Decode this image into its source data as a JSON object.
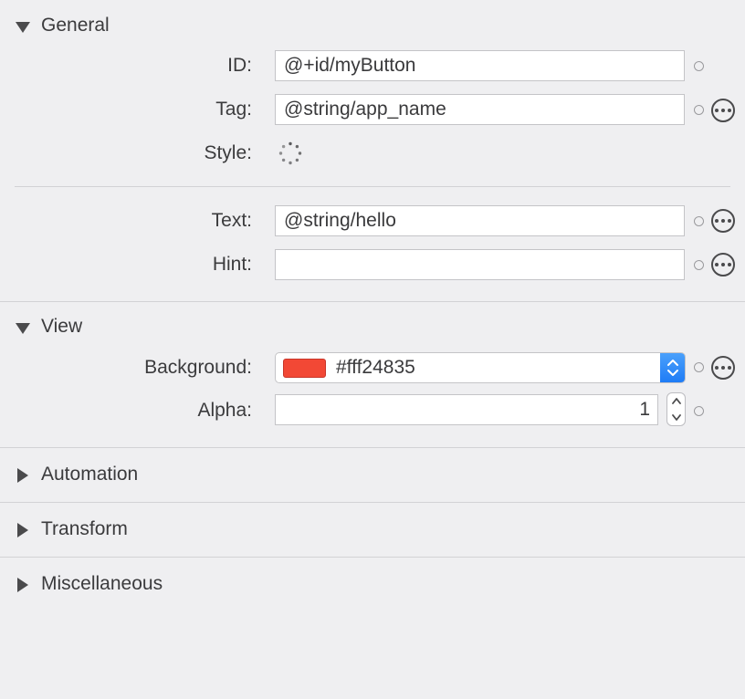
{
  "sections": {
    "general": {
      "title": "General",
      "expanded": true
    },
    "view": {
      "title": "View",
      "expanded": true
    },
    "automation": {
      "title": "Automation",
      "expanded": false
    },
    "transform": {
      "title": "Transform",
      "expanded": false
    },
    "miscellaneous": {
      "title": "Miscellaneous",
      "expanded": false
    }
  },
  "general": {
    "id": {
      "label": "ID:",
      "value": "@+id/myButton"
    },
    "tag": {
      "label": "Tag:",
      "value": "@string/app_name"
    },
    "style": {
      "label": "Style:",
      "loading_icon": "spinner-icon"
    },
    "text": {
      "label": "Text:",
      "value": "@string/hello"
    },
    "hint": {
      "label": "Hint:",
      "value": ""
    }
  },
  "view": {
    "background": {
      "label": "Background:",
      "value": "#fff24835",
      "swatch_color": "#f24835"
    },
    "alpha": {
      "label": "Alpha:",
      "value": "1"
    }
  },
  "colors": {
    "panel_background": "#efeff1",
    "accent": "#1f7cf6",
    "label_text": "#3b3b3d"
  },
  "icons": {
    "more": "ellipsis-circle-icon",
    "binding_indicator": "small-circle-icon",
    "disclosure_open": "triangle-down-icon",
    "disclosure_closed": "triangle-right-icon",
    "popup_arrows": "up-down-chevron-icon"
  }
}
